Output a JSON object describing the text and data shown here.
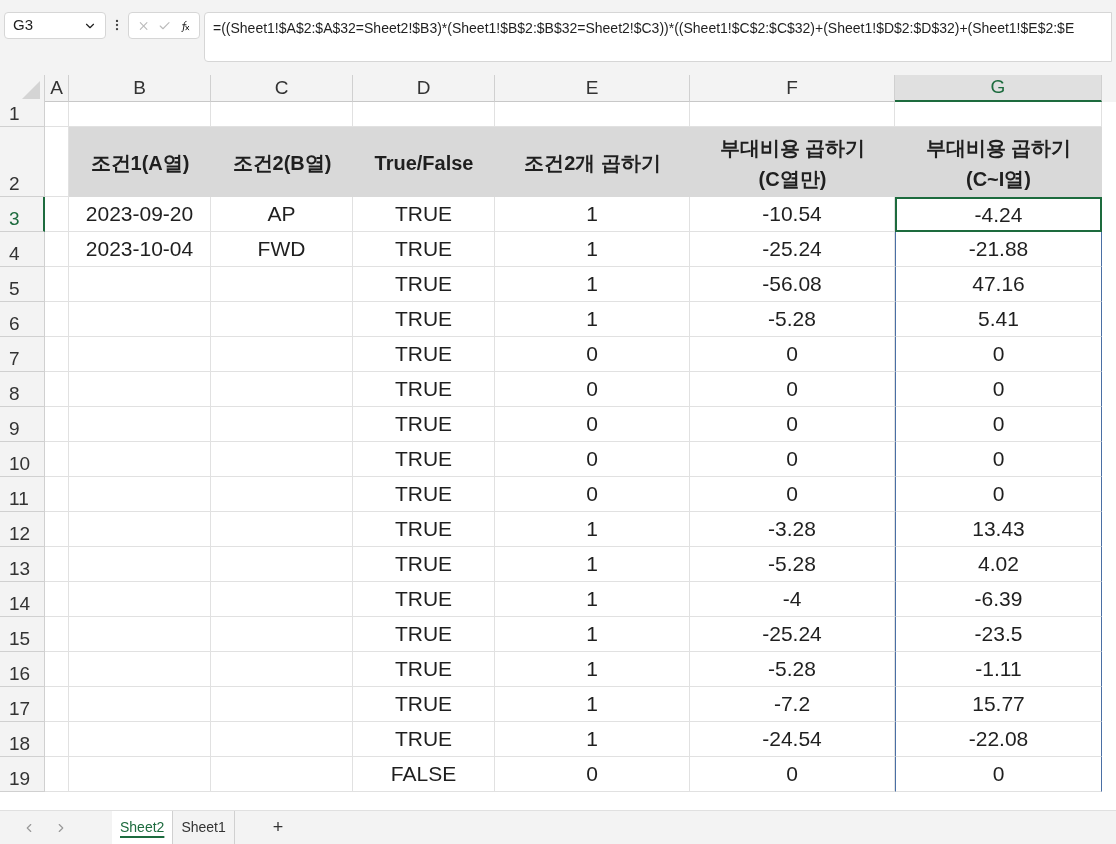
{
  "name_box": "G3",
  "formula_bar": {
    "formula": "=((Sheet1!$A$2:$A$32=Sheet2!$B3)*(Sheet1!$B$2:$B$32=Sheet2!$C3))*((Sheet1!$C$2:$C$32)+(Sheet1!$D$2:$D$32)+(Sheet1!$E$2:$E"
  },
  "columns": [
    {
      "label": "A",
      "selected": false
    },
    {
      "label": "B",
      "selected": false
    },
    {
      "label": "C",
      "selected": false
    },
    {
      "label": "D",
      "selected": false
    },
    {
      "label": "E",
      "selected": false
    },
    {
      "label": "F",
      "selected": false
    },
    {
      "label": "G",
      "selected": true
    }
  ],
  "rows": [
    {
      "number": "1",
      "kind": "blank",
      "selected": false,
      "cells": [
        "",
        "",
        "",
        "",
        "",
        "",
        ""
      ]
    },
    {
      "number": "2",
      "kind": "header",
      "selected": false,
      "cells": [
        "",
        "조건1(A열)",
        "조건2(B열)",
        "True/False",
        "조건2개 곱하기",
        "부대비용 곱하기\n(C열만)",
        "부대비용 곱하기\n(C~I열)"
      ]
    },
    {
      "number": "3",
      "kind": "data",
      "selected": true,
      "cells": [
        "",
        "2023-09-20",
        "AP",
        "TRUE",
        "1",
        "-10.54",
        "-4.24"
      ]
    },
    {
      "number": "4",
      "kind": "data",
      "selected": false,
      "cells": [
        "",
        "2023-10-04",
        "FWD",
        "TRUE",
        "1",
        "-25.24",
        "-21.88"
      ]
    },
    {
      "number": "5",
      "kind": "data",
      "selected": false,
      "cells": [
        "",
        "",
        "",
        "TRUE",
        "1",
        "-56.08",
        "47.16"
      ]
    },
    {
      "number": "6",
      "kind": "data",
      "selected": false,
      "cells": [
        "",
        "",
        "",
        "TRUE",
        "1",
        "-5.28",
        "5.41"
      ]
    },
    {
      "number": "7",
      "kind": "data",
      "selected": false,
      "cells": [
        "",
        "",
        "",
        "TRUE",
        "0",
        "0",
        "0"
      ]
    },
    {
      "number": "8",
      "kind": "data",
      "selected": false,
      "cells": [
        "",
        "",
        "",
        "TRUE",
        "0",
        "0",
        "0"
      ]
    },
    {
      "number": "9",
      "kind": "data",
      "selected": false,
      "cells": [
        "",
        "",
        "",
        "TRUE",
        "0",
        "0",
        "0"
      ]
    },
    {
      "number": "10",
      "kind": "data",
      "selected": false,
      "cells": [
        "",
        "",
        "",
        "TRUE",
        "0",
        "0",
        "0"
      ]
    },
    {
      "number": "11",
      "kind": "data",
      "selected": false,
      "cells": [
        "",
        "",
        "",
        "TRUE",
        "0",
        "0",
        "0"
      ]
    },
    {
      "number": "12",
      "kind": "data",
      "selected": false,
      "cells": [
        "",
        "",
        "",
        "TRUE",
        "1",
        "-3.28",
        "13.43"
      ]
    },
    {
      "number": "13",
      "kind": "data",
      "selected": false,
      "cells": [
        "",
        "",
        "",
        "TRUE",
        "1",
        "-5.28",
        "4.02"
      ]
    },
    {
      "number": "14",
      "kind": "data",
      "selected": false,
      "cells": [
        "",
        "",
        "",
        "TRUE",
        "1",
        "-4",
        "-6.39"
      ]
    },
    {
      "number": "15",
      "kind": "data",
      "selected": false,
      "cells": [
        "",
        "",
        "",
        "TRUE",
        "1",
        "-25.24",
        "-23.5"
      ]
    },
    {
      "number": "16",
      "kind": "data",
      "selected": false,
      "cells": [
        "",
        "",
        "",
        "TRUE",
        "1",
        "-5.28",
        "-1.11"
      ]
    },
    {
      "number": "17",
      "kind": "data",
      "selected": false,
      "cells": [
        "",
        "",
        "",
        "TRUE",
        "1",
        "-7.2",
        "15.77"
      ]
    },
    {
      "number": "18",
      "kind": "data",
      "selected": false,
      "cells": [
        "",
        "",
        "",
        "TRUE",
        "1",
        "-24.54",
        "-22.08"
      ]
    },
    {
      "number": "19",
      "kind": "data",
      "selected": false,
      "cells": [
        "",
        "",
        "",
        "FALSE",
        "0",
        "0",
        "0"
      ]
    }
  ],
  "sheet_tabs": [
    {
      "label": "Sheet2",
      "selected": true
    },
    {
      "label": "Sheet1",
      "selected": false
    }
  ],
  "add_sheet": "+"
}
